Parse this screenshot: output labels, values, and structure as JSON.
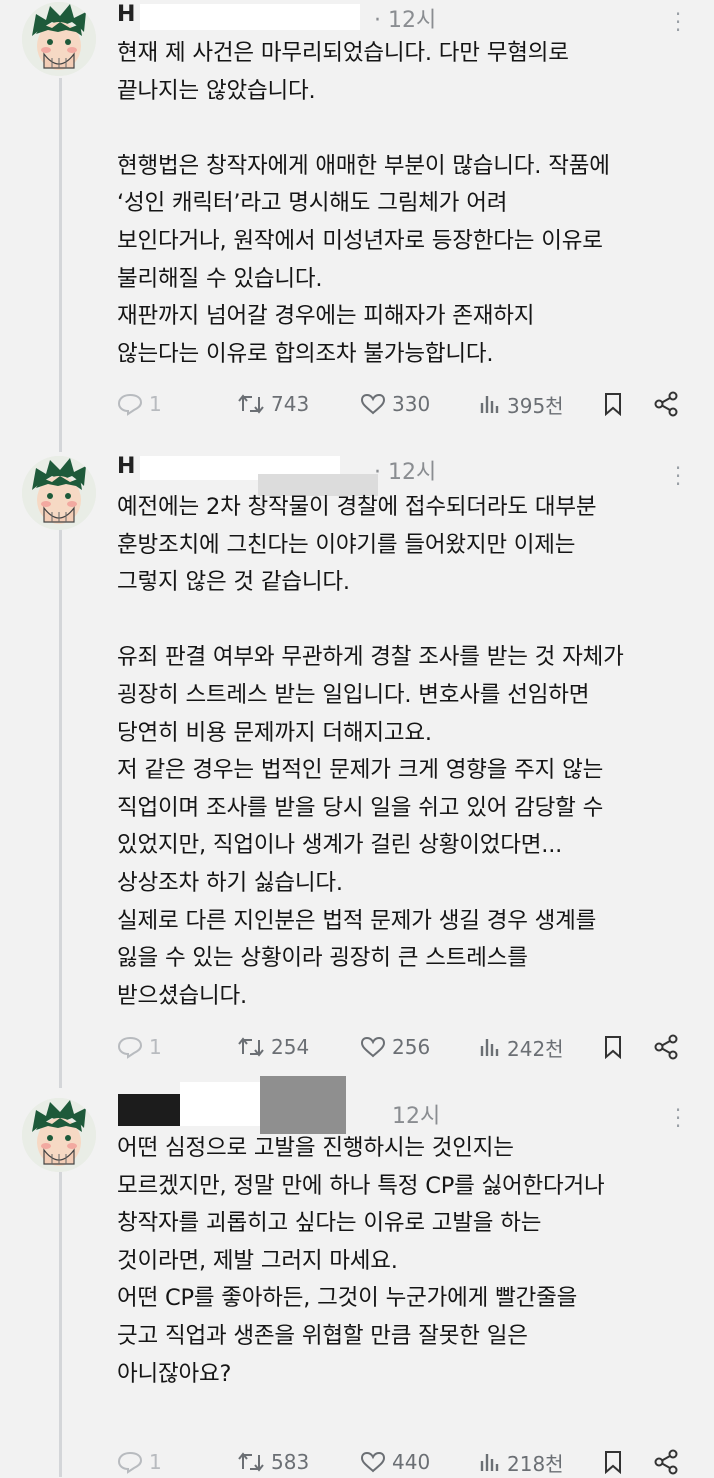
{
  "tweets": [
    {
      "name": "H",
      "time": "· 12시",
      "lines": [
        "현재 제 사건은 마무리되었습니다. 다만 무혐의로",
        "끝나지는 않았습니다.",
        "",
        "현행법은 창작자에게 애매한 부분이 많습니다. 작품에",
        "‘성인 캐릭터’라고 명시해도 그림체가 어려",
        "보인다거나, 원작에서 미성년자로 등장한다는 이유로",
        "불리해질 수 있습니다.",
        "재판까지 넘어갈 경우에는 피해자가 존재하지",
        "않는다는 이유로 합의조차 불가능합니다."
      ],
      "replies": "1",
      "retweets": "743",
      "likes": "330",
      "views": "395천"
    },
    {
      "name": "H",
      "time": "· 12시",
      "lines": [
        "예전에는 2차 창작물이 경찰에 접수되더라도 대부분",
        "훈방조치에 그친다는 이야기를 들어왔지만 이제는",
        "그렇지 않은 것 같습니다.",
        "",
        "유죄 판결 여부와 무관하게 경찰 조사를 받는 것 자체가",
        "굉장히 스트레스 받는 일입니다. 변호사를 선임하면",
        "당연히 비용 문제까지 더해지고요.",
        "저 같은 경우는 법적인 문제가 크게 영향을 주지 않는",
        "직업이며 조사를 받을 당시 일을 쉬고 있어 감당할 수",
        "있었지만, 직업이나 생계가 걸린 상황이었다면...",
        "상상조차 하기 싫습니다.",
        "실제로 다른 지인분은 법적 문제가 생길 경우 생계를",
        "잃을 수 있는 상황이라 굉장히 큰 스트레스를",
        "받으셨습니다."
      ],
      "replies": "1",
      "retweets": "254",
      "likes": "256",
      "views": "242천"
    },
    {
      "name": "",
      "time": "12시",
      "lines": [
        "어떤 심정으로 고발을 진행하시는 것인지는",
        "모르겠지만, 정말 만에 하나 특정 CP를 싫어한다거나",
        "창작자를 괴롭히고 싶다는 이유로 고발을 하는",
        "것이라면, 제발 그러지 마세요.",
        "어떤 CP를 좋아하든, 그것이 누군가에게 빨간줄을",
        "긋고 직업과 생존을 위협할 만큼 잘못한 일은",
        "아니잖아요?"
      ],
      "replies": "1",
      "retweets": "583",
      "likes": "440",
      "views": "218천"
    }
  ]
}
